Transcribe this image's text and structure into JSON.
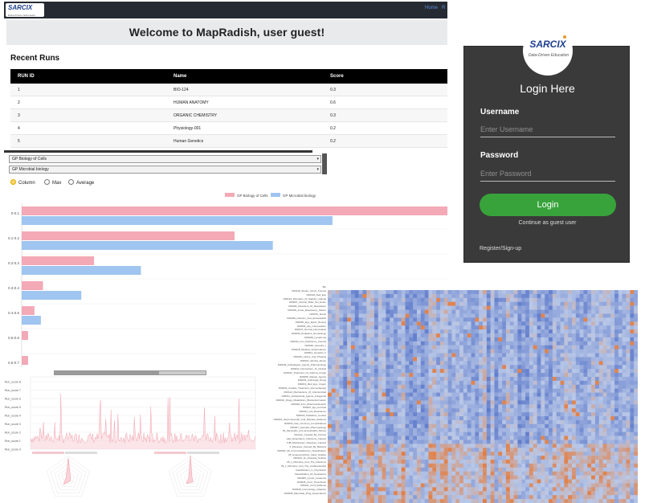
{
  "dashboard": {
    "logo": "SARCIX",
    "logo_sub": "Data-Driven Education",
    "nav": [
      "Home",
      "R"
    ],
    "welcome": "Welcome to MapRadish, user guest!",
    "recent_runs_title": "Recent Runs",
    "table": {
      "headers": [
        "RUN ID",
        "Name",
        "Score"
      ],
      "rows": [
        [
          "1",
          "BIO-124",
          "0.3"
        ],
        [
          "2",
          "HUMAN ANATOMY",
          "0.6"
        ],
        [
          "3",
          "ORGANIC CHEMISTRY",
          "0.3"
        ],
        [
          "4",
          "Physiology-001",
          "0.2"
        ],
        [
          "5",
          "Human Genetics",
          "0.2"
        ]
      ]
    }
  },
  "login": {
    "logo": "SARCIX",
    "logo_sub": "Data-Driven Education",
    "title": "Login Here",
    "username_label": "Username",
    "username_placeholder": "Enter Username",
    "password_label": "Password",
    "password_placeholder": "Enter Password",
    "login_button": "Login",
    "guest_link": "Continue as guest user",
    "register_link": "Register/Sign-up"
  },
  "bar_panel": {
    "selects": [
      "GP Biology of Cells",
      "GP Microbial biology"
    ],
    "radios": [
      {
        "label": "Column",
        "checked": true
      },
      {
        "label": "Max",
        "checked": false
      },
      {
        "label": "Average",
        "checked": false
      }
    ],
    "colors": {
      "series1": "#f3a9b6",
      "series2": "#9fc5f0"
    }
  },
  "chart_data": [
    {
      "type": "bar",
      "orientation": "horizontal",
      "categories": [
        "0-0.1",
        "0.1-0.2",
        "0.2-0.3",
        "0.3-0.4",
        "0.4-0.5",
        "0.5-0.6",
        "0.6-0.7"
      ],
      "series": [
        {
          "name": "GP Biology of Cells",
          "values": [
            100,
            50,
            17,
            5,
            3,
            1.5,
            1.5
          ]
        },
        {
          "name": "GP Microbial biology",
          "values": [
            73,
            59,
            28,
            14,
            4.5,
            0,
            0
          ]
        }
      ],
      "xlim": [
        0,
        100
      ]
    }
  ],
  "line_panel": {
    "y_labels": [
      "Run_score 8",
      "Run_score 7",
      "Run_score 6",
      "Run_score 5",
      "Run_score 4",
      "Run_score 3",
      "Run_score 2",
      "Run_score 1",
      "Run_score 0"
    ],
    "colors": {
      "line": "#f2a3ae",
      "fill": "#f9d3d9"
    }
  },
  "heatmap": {
    "colors": {
      "low": "#4a69c4",
      "mid": "#b9c8e8",
      "high": "#e57a3a"
    },
    "row_labels": [
      "Bio",
      "D00118_Stroke_Cervic_Trauma",
      "D00128_Red_Eye",
      "D00124_Disorders_Of_Salivary_Glands",
      "D00007_Clinical_Skills_Set_Exam",
      "D00031_Disorders_Of_Respiration",
      "D00045_Acute_Respiratory_Failure",
      "D00070_Shock",
      "D00048_Infection_And_Endocarditis",
      "D00050_Eye_Electr_Review",
      "D00054_Hip_Interpretation",
      "D00047_Normal_Hemostasis",
      "D00043_Pediatrics_Hematology",
      "D00038_Lymphoma",
      "D00011_Iron_Deficiency_Anemia",
      "D00029_Genetics_I",
      "D00018_Medical_Jurisprudence",
      "D00011_Genetics_II",
      "D00015_Ulcers_And_Physical",
      "D00016_Alcohol_Abuse",
      "D00049_Antiepileptic_Agents_Pharmacology",
      "D00010_Introduction_To_Clinical",
      "D00034_Treatment_Of_Asthma_Cough",
      "D00008_Allergic_Agents",
      "D00033_Antifungal_Drugs",
      "D00019_Red_Eye_Urgent",
      "D00032_Cardiac_Treatment_Chemotherapy",
      "D00112_Mechanisms_Of_Antimicrobial",
      "D00011_Antibacterial_Agents_Antagonist",
      "D00016_Drugs_Metabolism_Biotransformation",
      "D00029_Intro_Pharmacokinetics",
      "D00027_Epi_Cervical",
      "D00021_Life_Resistance",
      "D00018_Pediatrics_Lumbar",
      "D00034_Neuromuscular_And_Disease_Reflexes",
      "D00033_Gas_Common_Complications",
      "D00027_Vascular_Rheumatology",
      "0b_Meningitis_And_Encephalitis_Mouse",
      "Infection_Caused_By_Viruses",
      "past_Respiratory_Infections_Caused",
      "CJB_Multisystem_Diseases_Caused",
      "2_Diseases_Caused_By_Bacteria",
      "D00031_05_Immunodeficiency_Classification",
      "05_Hypersensitivity_Class_Studies",
      "D00015_11_Classical_Studies",
      "05_1_Microbes_And_The_Infections",
      "06_1_Microbes_And_The_Cardiovascular",
      "Classification_In_Psychiatric",
      "Classification_Of_Neoplasms",
      "D00005_Lymph_Leukemia",
      "D00045_Cord_Thrombosis",
      "D00011_Cord_Reflexes",
      "D00049_Immunology_Adaptive",
      "D00035_Macrolide_Drug_Dependence"
    ]
  }
}
